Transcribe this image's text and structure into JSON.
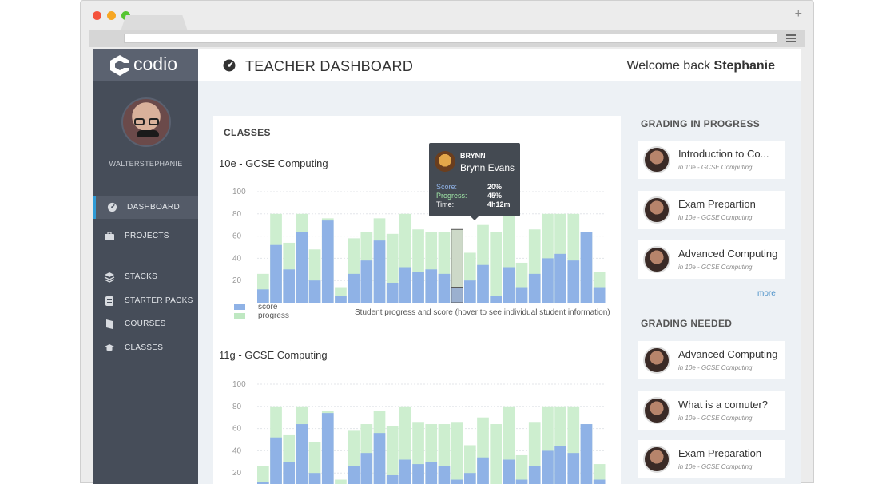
{
  "app": {
    "logo_text": "codio",
    "page_title": "TEACHER DASHBOARD",
    "welcome_prefix": "Welcome back ",
    "welcome_name": "Stephanie"
  },
  "sidebar": {
    "username": "WALTERSTEPHANIE",
    "items": [
      {
        "label": "DASHBOARD",
        "icon": "dashboard-icon"
      },
      {
        "label": "PROJECTS",
        "icon": "briefcase-icon"
      },
      {
        "label": "STACKS",
        "icon": "stack-icon"
      },
      {
        "label": "STARTER PACKS",
        "icon": "starter-pack-icon"
      },
      {
        "label": "COURSES",
        "icon": "book-icon"
      },
      {
        "label": "CLASSES",
        "icon": "graduation-cap-icon"
      }
    ]
  },
  "classes": {
    "heading": "CLASSES",
    "class1_title": "10e - GCSE Computing",
    "class2_title": "11g - GCSE Computing",
    "legend_score": "score",
    "legend_progress": "progress",
    "caption": "Student progress and score (hover to see individual student information)"
  },
  "tooltip": {
    "short_name": "BRYNN",
    "full_name": "Brynn Evans",
    "score_label": "Score:",
    "score_value": "20%",
    "progress_label": "Progress:",
    "progress_value": "45%",
    "time_label": "Time:",
    "time_value": "4h12m"
  },
  "grading_in_progress": {
    "heading": "GRADING IN PROGRESS",
    "items": [
      {
        "title": "Introduction to Co...",
        "sub": "in 10e - GCSE Computing"
      },
      {
        "title": "Exam Prepartion",
        "sub": "in 10e - GCSE Computing"
      },
      {
        "title": "Advanced Computing",
        "sub": "in 10e - GCSE Computing"
      }
    ],
    "more": "more"
  },
  "grading_needed": {
    "heading": "GRADING NEEDED",
    "items": [
      {
        "title": "Advanced Computing",
        "sub": "in 10e - GCSE Computing"
      },
      {
        "title": "What is a comuter?",
        "sub": "in 10e - GCSE Computing"
      },
      {
        "title": "Exam Preparation",
        "sub": "in 10e - GCSE Computing"
      }
    ]
  },
  "colors": {
    "score": "#8fb2e6",
    "progress": "#cdeecf",
    "accent": "#2f9bd6",
    "sidebar": "#464d59"
  },
  "chart_data": [
    {
      "type": "bar",
      "title": "10e - GCSE Computing",
      "ylim": [
        0,
        100
      ],
      "yticks": [
        20,
        40,
        60,
        80,
        100
      ],
      "grid": true,
      "highlight_index": 15,
      "series": [
        {
          "name": "score",
          "values": [
            12,
            52,
            30,
            64,
            20,
            74,
            6,
            26,
            38,
            56,
            18,
            32,
            28,
            30,
            26,
            14,
            20,
            34,
            6,
            32,
            14,
            26,
            40,
            44,
            38,
            64,
            14
          ]
        },
        {
          "name": "progress",
          "values": [
            26,
            80,
            54,
            80,
            48,
            76,
            14,
            58,
            64,
            76,
            62,
            80,
            66,
            64,
            64,
            66,
            45,
            70,
            64,
            80,
            36,
            66,
            80,
            80,
            80,
            64,
            28
          ]
        }
      ]
    },
    {
      "type": "bar",
      "title": "11g - GCSE Computing",
      "ylim": [
        0,
        100
      ],
      "yticks": [
        20,
        40,
        60,
        80,
        100
      ],
      "grid": true,
      "series": [
        {
          "name": "score",
          "values": [
            12,
            52,
            30,
            64,
            20,
            74,
            6,
            26,
            38,
            56,
            18,
            32,
            28,
            30,
            26,
            14,
            20,
            34,
            6,
            32,
            14,
            26,
            40,
            44,
            38,
            64,
            14
          ]
        },
        {
          "name": "progress",
          "values": [
            26,
            80,
            54,
            80,
            48,
            76,
            14,
            58,
            64,
            76,
            62,
            80,
            66,
            64,
            64,
            66,
            45,
            70,
            64,
            80,
            36,
            66,
            80,
            80,
            80,
            64,
            28
          ]
        }
      ]
    }
  ]
}
